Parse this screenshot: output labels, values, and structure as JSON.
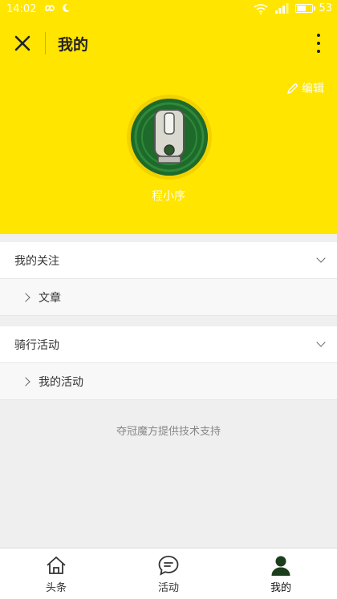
{
  "status_bar": {
    "time": "14:02",
    "battery": "53",
    "battery_level": 0.53
  },
  "header": {
    "title": "我的",
    "edit_label": "编辑"
  },
  "profile": {
    "username": "程小序"
  },
  "sections": [
    {
      "title": "我的关注",
      "items": [
        "文章"
      ]
    },
    {
      "title": "骑行活动",
      "items": [
        "我的活动"
      ]
    }
  ],
  "footer_note": "夺冠魔方提供技术支持",
  "tabbar": {
    "tabs": [
      {
        "label": "头条",
        "icon": "home-icon"
      },
      {
        "label": "活动",
        "icon": "chat-icon"
      },
      {
        "label": "我的",
        "icon": "user-icon",
        "active": true
      }
    ]
  },
  "colors": {
    "accent": "#ffe500",
    "background": "#efefef"
  }
}
